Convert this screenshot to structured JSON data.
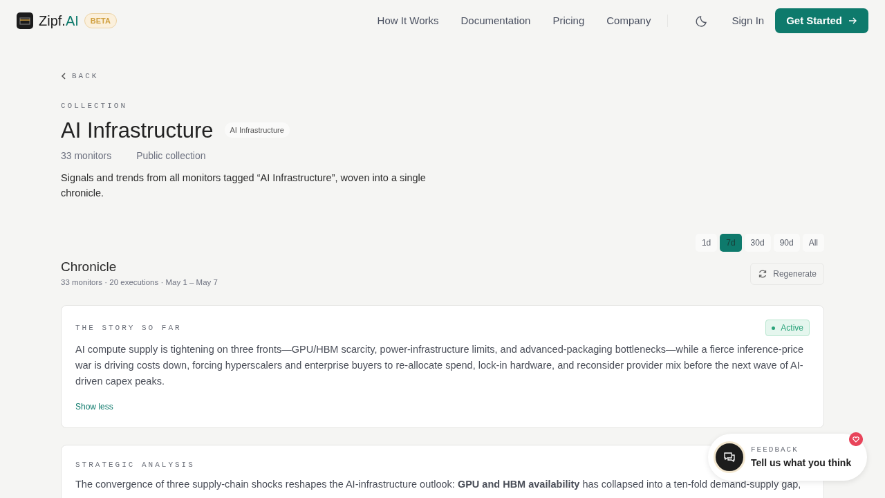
{
  "navbar": {
    "brand": "Zipf.",
    "brand_accent": "AI",
    "badge": "BETA",
    "links": [
      "How It Works",
      "Documentation",
      "Pricing",
      "Company"
    ],
    "sign_in": "Sign In",
    "cta": "Get Started"
  },
  "back": "BACK",
  "eyebrow": "COLLECTION",
  "title": "AI Infrastructure",
  "tag": "AI Infrastructure",
  "meta": [
    "33 monitors",
    "Public collection"
  ],
  "description": "Signals and trends from all monitors tagged “AI Infrastructure”, woven into a single chronicle.",
  "ranges": [
    {
      "label": "1d",
      "selected": false
    },
    {
      "label": "7d",
      "selected": true
    },
    {
      "label": "30d",
      "selected": false
    },
    {
      "label": "90d",
      "selected": false
    },
    {
      "label": "All",
      "selected": false
    }
  ],
  "chronicle": {
    "title": "Chronicle",
    "subtitle": "33 monitors · 20 executions · May 1 – May 7",
    "regenerate": "Regenerate"
  },
  "cards": [
    {
      "heading": "THE STORY SO FAR",
      "status": "Active",
      "text": "AI compute supply is tightening on three fronts—GPU/HBM scarcity, power-infrastructure limits, and advanced-packaging bottlenecks—while a fierce inference-price war is driving costs down, forcing hyperscalers and enterprise buyers to re-allocate spend, lock-in hardware, and reconsider provider mix before the next wave of AI-driven capex peaks.",
      "toggle": "Show less"
    },
    {
      "heading": "STRATEGIC ANALYSIS",
      "text": "The convergence of three supply-chain shocks reshapes the AI-infrastructure outlook: **GPU and HBM availability** has collapsed into a ten-fold demand-supply gap,"
    }
  ],
  "feedback": {
    "label": "FEEDBACK",
    "text": "Tell us what you think"
  }
}
